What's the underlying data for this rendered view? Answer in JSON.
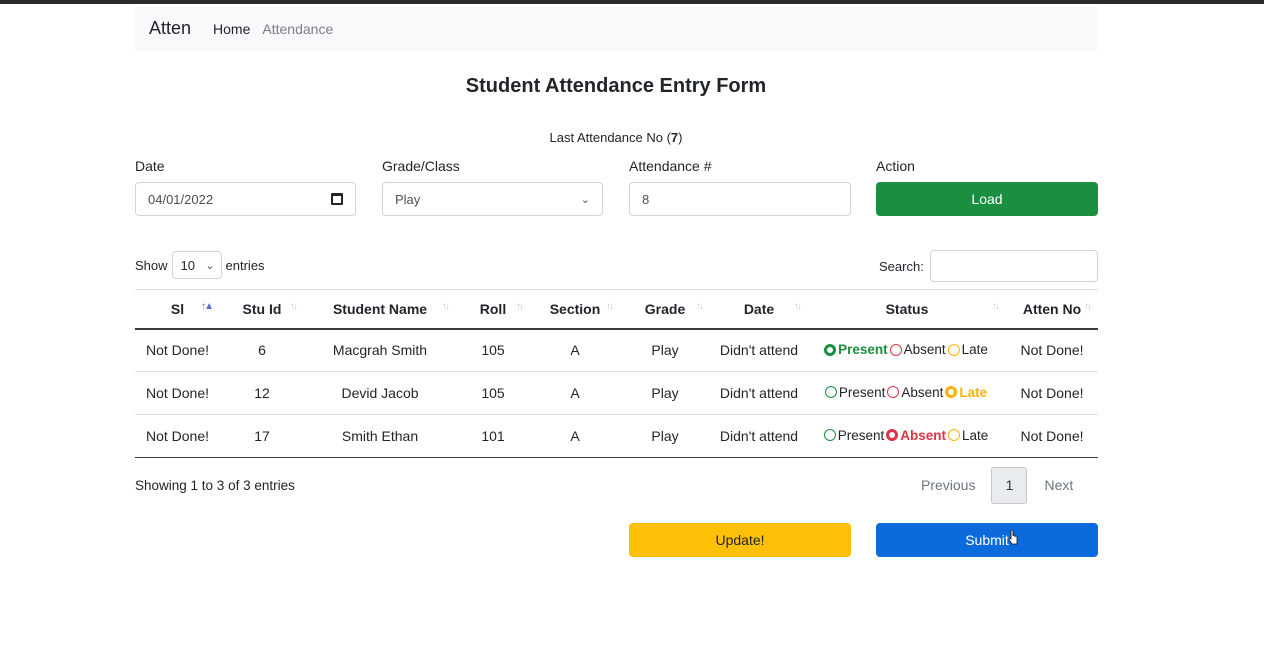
{
  "navbar": {
    "brand": "Atten",
    "links": [
      "Home",
      "Attendance"
    ]
  },
  "page_title": "Student Attendance Entry Form",
  "last_attendance": {
    "prefix": "Last Attendance No (",
    "number": "7",
    "suffix": ")"
  },
  "form": {
    "date_label": "Date",
    "date_value": "04/01/2022",
    "grade_label": "Grade/Class",
    "grade_value": "Play",
    "attendance_label": "Attendance #",
    "attendance_value": "8",
    "action_label": "Action",
    "load_label": "Load"
  },
  "table_controls": {
    "show": "Show",
    "entries_value": "10",
    "entries": "entries",
    "search_label": "Search:"
  },
  "columns": [
    "Sl",
    "Stu Id",
    "Student Name",
    "Roll",
    "Section",
    "Grade",
    "Date",
    "Status",
    "Atten No"
  ],
  "rows": [
    {
      "sl": "Not Done!",
      "stu_id": "6",
      "name": "Macgrah Smith",
      "roll": "105",
      "section": "A",
      "grade": "Play",
      "date": "Didn't attend",
      "status": "Present",
      "atten_no": "Not Done!"
    },
    {
      "sl": "Not Done!",
      "stu_id": "12",
      "name": "Devid Jacob",
      "roll": "105",
      "section": "A",
      "grade": "Play",
      "date": "Didn't attend",
      "status": "Late",
      "atten_no": "Not Done!"
    },
    {
      "sl": "Not Done!",
      "stu_id": "17",
      "name": "Smith Ethan",
      "roll": "101",
      "section": "A",
      "grade": "Play",
      "date": "Didn't attend",
      "status": "Absent",
      "atten_no": "Not Done!"
    }
  ],
  "status_options": [
    "Present",
    "Absent",
    "Late"
  ],
  "footer": {
    "info": "Showing 1 to 3 of 3 entries",
    "previous": "Previous",
    "page": "1",
    "next": "Next"
  },
  "buttons": {
    "update": "Update!",
    "submit": "Submit"
  },
  "colors": {
    "load": "#198f3f",
    "update": "#ffc107",
    "submit": "#0b6bdc",
    "present": "#198f3f",
    "absent": "#dc3545",
    "late": "#ffb300"
  }
}
